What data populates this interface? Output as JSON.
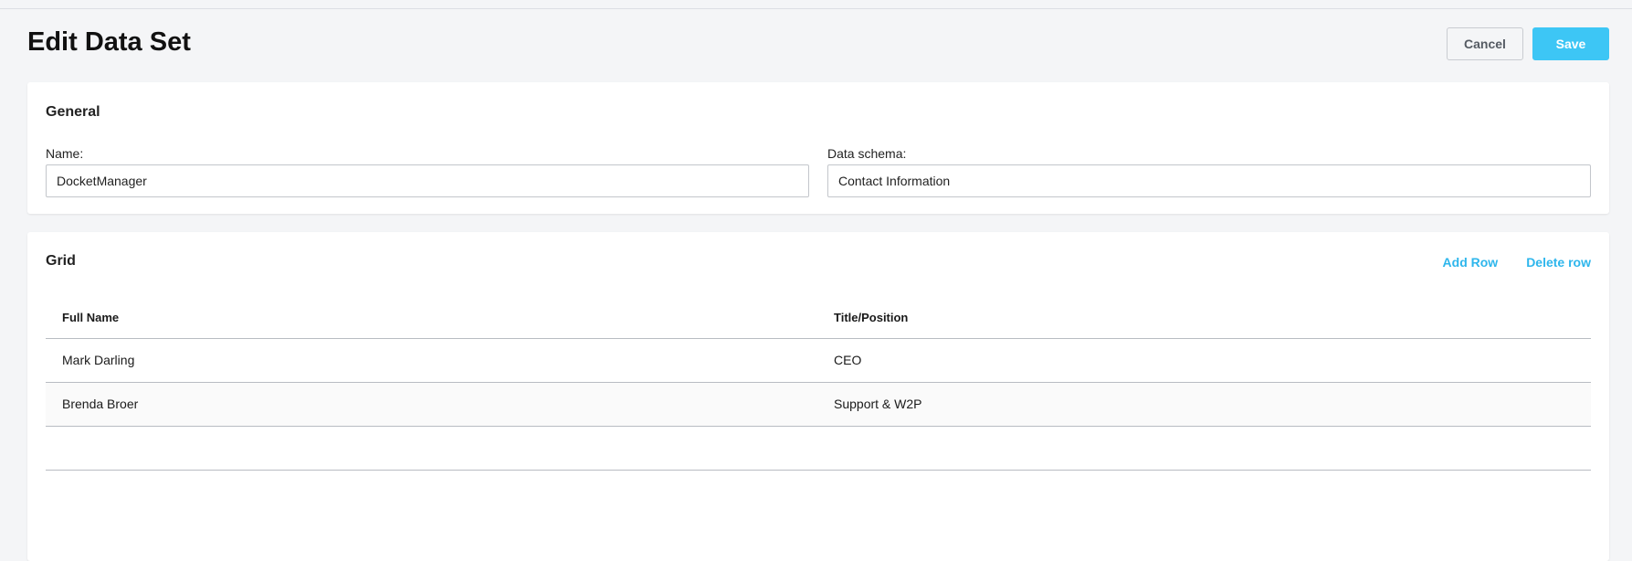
{
  "page": {
    "title": "Edit Data Set"
  },
  "actions": {
    "cancel_label": "Cancel",
    "save_label": "Save"
  },
  "general": {
    "title": "General",
    "name_label": "Name:",
    "name_value": "DocketManager",
    "schema_label": "Data schema:",
    "schema_value": "Contact Information"
  },
  "grid": {
    "title": "Grid",
    "add_row_label": "Add Row",
    "delete_row_label": "Delete row",
    "columns": [
      "Full Name",
      "Title/Position"
    ],
    "rows": [
      [
        "Mark Darling",
        "CEO"
      ],
      [
        "Brenda Broer",
        "Support & W2P"
      ],
      [
        "",
        ""
      ]
    ]
  },
  "colors": {
    "accent": "#3dc6f5",
    "link": "#2eb6ec",
    "background": "#f4f5f7"
  }
}
